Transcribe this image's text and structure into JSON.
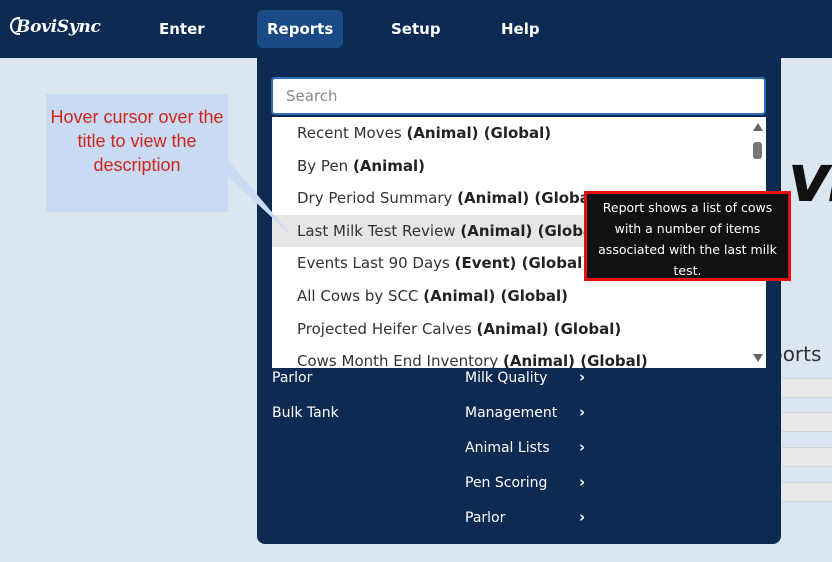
{
  "app": {
    "logo": "BoviSync"
  },
  "nav": {
    "enter": "Enter",
    "reports": "Reports",
    "setup": "Setup",
    "help": "Help"
  },
  "background": {
    "big_text": "vi",
    "reports_text": "ports"
  },
  "search": {
    "placeholder": "Search",
    "value": ""
  },
  "results": [
    {
      "name": "Recent Moves",
      "tags": "(Animal) (Global)"
    },
    {
      "name": "By Pen",
      "tags": "(Animal)"
    },
    {
      "name": "Dry Period Summary",
      "tags": "(Animal) (Global)"
    },
    {
      "name": "Last Milk Test Review",
      "tags": "(Animal) (Global)"
    },
    {
      "name": "Events Last 90 Days",
      "tags": "(Event) (Global)"
    },
    {
      "name": "All Cows by SCC",
      "tags": "(Animal) (Global)"
    },
    {
      "name": "Projected Heifer Calves",
      "tags": "(Animal) (Global)"
    },
    {
      "name": "Cows Month End Inventory",
      "tags": "(Animal) (Global)"
    }
  ],
  "menu_left": [
    "Parlor",
    "Bulk Tank"
  ],
  "menu_right": [
    "Milk Quality",
    "Management",
    "Animal Lists",
    "Pen Scoring",
    "Parlor"
  ],
  "chevron": "›",
  "callout": {
    "text": "Hover cursor over the title to view the description"
  },
  "tooltip": {
    "text": "Report shows a list of cows with a number of items associated with the last milk test."
  },
  "colors": {
    "nav_bg": "#0d2a52",
    "nav_active": "#1a4a86",
    "page_bg": "#dce6f1",
    "callout_bg": "#c9daf3",
    "callout_text": "#d0251b",
    "tooltip_border": "#e01010"
  }
}
